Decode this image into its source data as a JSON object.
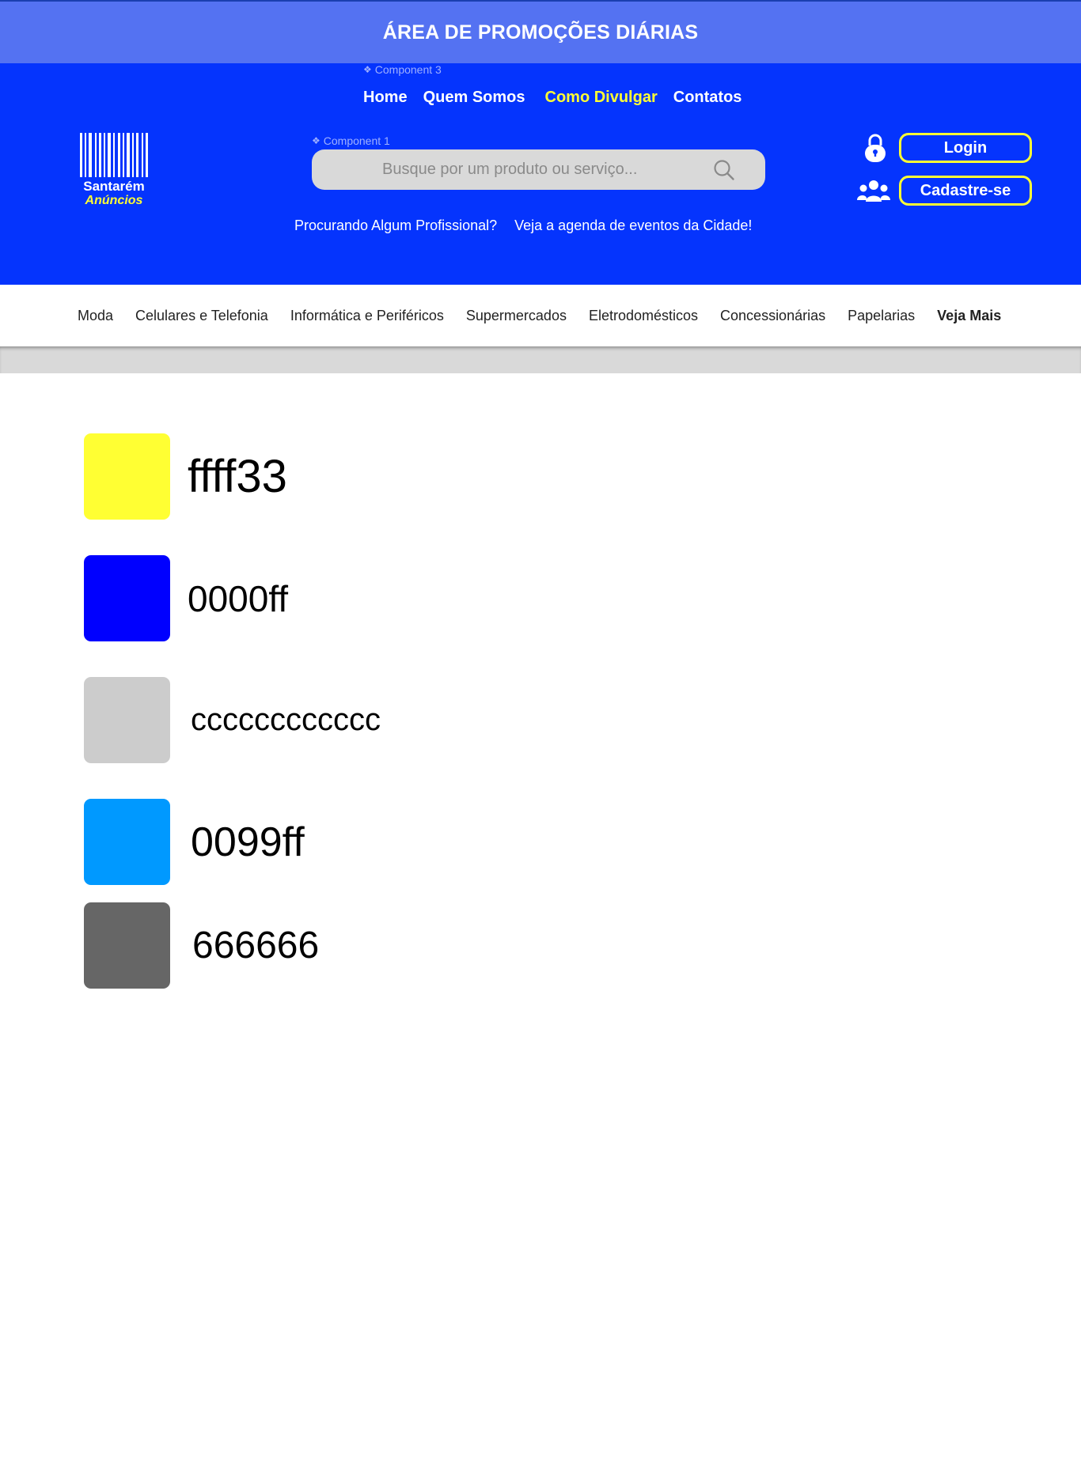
{
  "promo": {
    "title": "ÁREA DE PROMOÇÕES DIÁRIAS"
  },
  "components": {
    "nav_tag": "Component 3",
    "search_tag": "Component 1"
  },
  "nav": [
    {
      "label": "Home"
    },
    {
      "label": "Quem Somos"
    },
    {
      "label": "Como Divulgar",
      "active": true
    },
    {
      "label": "Contatos"
    }
  ],
  "logo": {
    "name": "Santarém",
    "sub": "Anúncios"
  },
  "search": {
    "placeholder": "Busque por um produto ou serviço..."
  },
  "sub_links": [
    "Procurando Algum Profissional?",
    "Veja a agenda de eventos da Cidade!"
  ],
  "auth": {
    "login": "Login",
    "signup": "Cadastre-se"
  },
  "categories": [
    "Moda",
    "Celulares e Telefonia",
    "Informática e Periféricos",
    "Supermercados",
    "Eletrodomésticos",
    "Concessionárias",
    "Papelarias",
    "Veja Mais"
  ],
  "palette": [
    {
      "label": "ffff33",
      "color": "#ffff33"
    },
    {
      "label": "0000ff",
      "color": "#0000ff"
    },
    {
      "label": "cccccccccccc",
      "color": "#cccccc"
    },
    {
      "label": "0099ff",
      "color": "#0099ff"
    },
    {
      "label": "666666",
      "color": "#666666"
    }
  ],
  "colors": {
    "header": "#0534fd",
    "promo": "#5472f2",
    "accent": "#ffff33"
  }
}
